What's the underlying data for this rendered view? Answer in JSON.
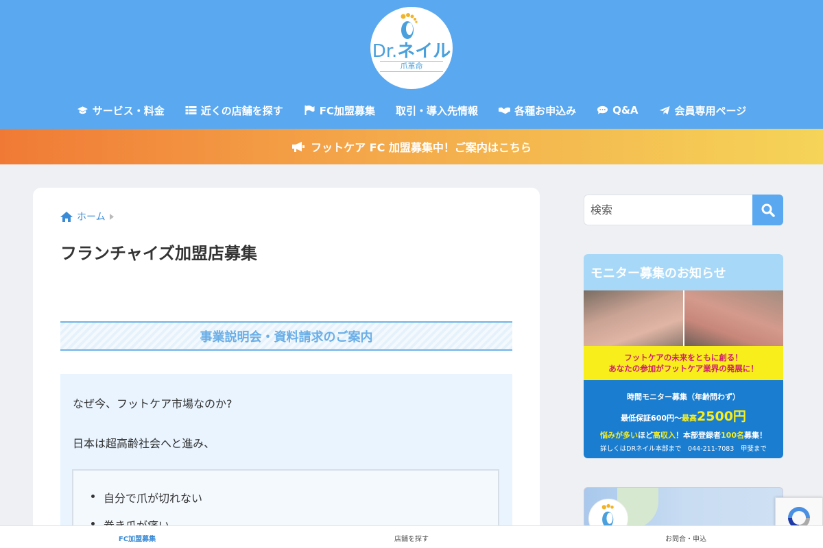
{
  "header": {
    "logo": {
      "brand": "Dr.ネイル",
      "brand_prefix": "Dr.",
      "brand_name": "ネイル",
      "tagline": "爪革命"
    },
    "nav": [
      {
        "label": "サービス・料金",
        "icon": "graduation-cap-icon"
      },
      {
        "label": "近くの店舗を探す",
        "icon": "list-icon"
      },
      {
        "label": "FC加盟募集",
        "icon": "flag-icon"
      },
      {
        "label": "取引・導入先情報",
        "icon": ""
      },
      {
        "label": "各種お申込み",
        "icon": "handshake-icon"
      },
      {
        "label": "Q&A",
        "icon": "comments-icon"
      },
      {
        "label": "会員専用ページ",
        "icon": "paper-plane-icon"
      }
    ]
  },
  "banner": {
    "text": "フットケア FC 加盟募集中！ご案内はこちら",
    "icon": "bullhorn-icon"
  },
  "main": {
    "breadcrumb": {
      "home_label": "ホーム"
    },
    "title": "フランチャイズ加盟店募集",
    "section_heading": "事業説明会・資料請求のご案内",
    "paragraphs": [
      "なぜ今、フットケア市場なのか?",
      "日本は超高齢社会へと進み、"
    ],
    "bullets": [
      "自分で爪が切れない",
      "巻き爪が痛い"
    ]
  },
  "sidebar": {
    "search": {
      "placeholder": "検索"
    },
    "monitor_widget": {
      "title": "モニター募集のお知らせ",
      "yellow_line1": "フットケアの未来をともに創る！",
      "yellow_line2": "あなたの参加がフットケア業界の発展に！",
      "ad_line1": "時間モニター募集（年齢問わず）",
      "ad_min": "最低保証600円〜",
      "ad_max_label": "最高",
      "ad_max_value": "2500円",
      "ad_line3_a": "悩みが多い",
      "ad_line3_b": "ほど",
      "ad_line3_c": "高収入",
      "ad_line3_d": "！本部登録者",
      "ad_line3_e": "100名",
      "ad_line3_f": "募集！",
      "ad_contact": "詳しくはDRネイル本部まで　044-211-7083　甲斐まで"
    }
  },
  "footer": {
    "items": [
      {
        "label": "FC加盟募集",
        "active": true
      },
      {
        "label": "店舗を探す",
        "active": false
      },
      {
        "label": "お問合・申込",
        "active": false
      }
    ]
  },
  "colors": {
    "header_bg": "#5aa8f0",
    "banner_start": "#f07a35",
    "banner_end": "#f5d458",
    "link": "#3a8bd6",
    "section_heading": "#6aaee6"
  }
}
